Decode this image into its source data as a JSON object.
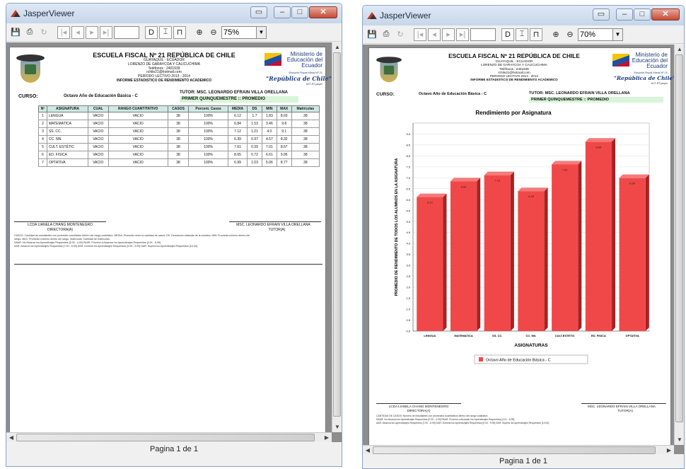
{
  "app": {
    "title": "JasperViewer",
    "status": "Pagina 1 de 1"
  },
  "windows": [
    {
      "zoom": "75%"
    },
    {
      "zoom": "70%"
    }
  ],
  "report": {
    "school": "ESCUELA FISCAL Nº 21 REPÚBLICA DE CHILE",
    "city": "GUAYAQUIL - ECUADOR",
    "address": "LORENZO DE GARAYCOA Y CALICUCHIMA",
    "phone": "Teléfonos : 2401939",
    "email": "rchile21@hotmail.com",
    "period": "PERIODO LECTIVO 2013 - 2014",
    "report_title": "INFORME ESTADISTICO DE RENDIMIENTO ACADEMICO",
    "ministry": "Ministerio de Educación del Ecuador",
    "school_short": "Escuela Fiscal Mixta Nº 21",
    "republic": "\"República de Chile\"",
    "code": "ACT-RT-jasper",
    "curso_label": "CURSO:",
    "curso": "Octavo Año de Educación Básica - C",
    "tutor": "TUTOR: MSC. LEONARDO EFRAIN VILLA ORELLANA",
    "period_label": "PRIMER QUINQUEMESTRE :: PROMEDIO",
    "table": {
      "headers": [
        "Nº",
        "ASIGNATURA",
        "CUAL",
        "RANGO CUANTITATIVO",
        "CASOS",
        "Porcent. Casos",
        "MEDIA",
        "DS",
        "MIN",
        "MAX",
        "Matrículas"
      ],
      "rows": [
        [
          "1",
          "LENGUA",
          "VACIO",
          "VACIO",
          "38",
          "100%",
          "6.12",
          "1.7",
          "1.83",
          "8.03",
          "38"
        ],
        [
          "2",
          "MATEMATICA",
          "VACIO",
          "VACIO",
          "38",
          "100%",
          "6.84",
          "1.53",
          "3.46",
          "9.8",
          "38"
        ],
        [
          "3",
          "SS. CC.",
          "VACIO",
          "VACIO",
          "38",
          "100%",
          "7.12",
          "1.21",
          "4.0",
          "9.1",
          "38"
        ],
        [
          "4",
          "CC. NN.",
          "VACIO",
          "VACIO",
          "38",
          "100%",
          "6.39",
          "0.97",
          "4.57",
          "8.32",
          "38"
        ],
        [
          "5",
          "CULT. ESTÉTIC",
          "VACIO",
          "VACIO",
          "38",
          "100%",
          "7.61",
          "0.39",
          "7.01",
          "8.67",
          "38"
        ],
        [
          "6",
          "ED. FISICA",
          "VACIO",
          "VACIO",
          "38",
          "100%",
          "8.65",
          "0.72",
          "6.61",
          "9.95",
          "38"
        ],
        [
          "7",
          "OPTATIVA",
          "VACIO",
          "VACIO",
          "38",
          "100%",
          "6.99",
          "1.03",
          "5.06",
          "8.77",
          "38"
        ]
      ]
    },
    "sign_left_name": "LCDA LIANELA CHANG MONTENEGRO",
    "sign_left_role": "DIRECTORA(A)",
    "sign_right_name": "MSC. LEONARDO EFRAIN VILLA ORELLANA",
    "sign_right_role": "TUTOR(A)",
    "legend_lines": [
      "CASOS: Cantidad de estudiantes con promedio cuantitativo dentro del rango cualitativo. MEDIA: Promedio entre la cantidad de casos. DS: Desviación estándar de la muestra. MIN: Promedio mínimo dentro del",
      "rango. MAX: Promedio máximo dentro del rango. Matrículas: Cantidad de matrículas.",
      "NAAR: No Alcanza los Aprendizajes Requeridos [0.00 - 4.00]     PAAR: Próximo a Alcanzar los Aprendizajes Requeridos [4.01 - 6.99]",
      "AAR: Alcanza los Aprendizajes Requeridos [7.00 - 8.99]     DAR: Domina los Aprendizajes Requeridos [9.00 - 9.99]     SAR: Supera los Aprendizajes Requeridos [10.00]"
    ],
    "legend_lines_short": [
      "CANTIDAD DE CASOS: Número de estudiantes con promedios cuantitativos dentro del rango cualitativo.",
      "NAAR: No Alcanza los Aprendizajes Requeridos [0.00 - 4.00]     PAAR: Próximo a Alcanzar los Aprendizajes Requeridos [4.01 - 6.99]",
      "AAR: Alcanza los Aprendizajes Requeridos [7.00 - 8.99]     DAR: Domina los Aprendizajes Requeridos [9.00 - 9.99]     SAR: Supera los Aprendizajes Requeridos [10.00]"
    ]
  },
  "chart_data": {
    "type": "bar",
    "title": "Rendimiento por Asignatura",
    "xlabel": "ASIGNATURAS",
    "ylabel": "PROMEDIO DE RENDIMIENTO DE TODOS LOS ALUMNOS EN LA ASIGNATURA",
    "categories": [
      "LENGUA",
      "MATEMATICA",
      "SS. CC.",
      "CC. NN.",
      "CULT.ESTETIC",
      "ED. FISICA",
      "OPTATIVA"
    ],
    "series": [
      {
        "name": "Octavo Año de Educación Básica - C",
        "values": [
          6.12,
          6.84,
          7.12,
          6.39,
          7.61,
          8.65,
          6.99
        ]
      }
    ],
    "data_labels": [
      "6.12",
      "6.84",
      "7.12",
      "6.39",
      "7.61",
      "8.65",
      "6.99"
    ],
    "ylim": [
      0,
      9.5
    ],
    "yticks": [
      "0.0",
      "0.5",
      "1.0",
      "1.5",
      "2.0",
      "2.5",
      "3.0",
      "3.5",
      "4.0",
      "4.5",
      "5.0",
      "5.5",
      "6.0",
      "6.5",
      "7.0",
      "7.5",
      "8.0",
      "8.5",
      "9.0"
    ],
    "bar_color": "#f04848",
    "legend_position": "bottom",
    "grid": true
  }
}
